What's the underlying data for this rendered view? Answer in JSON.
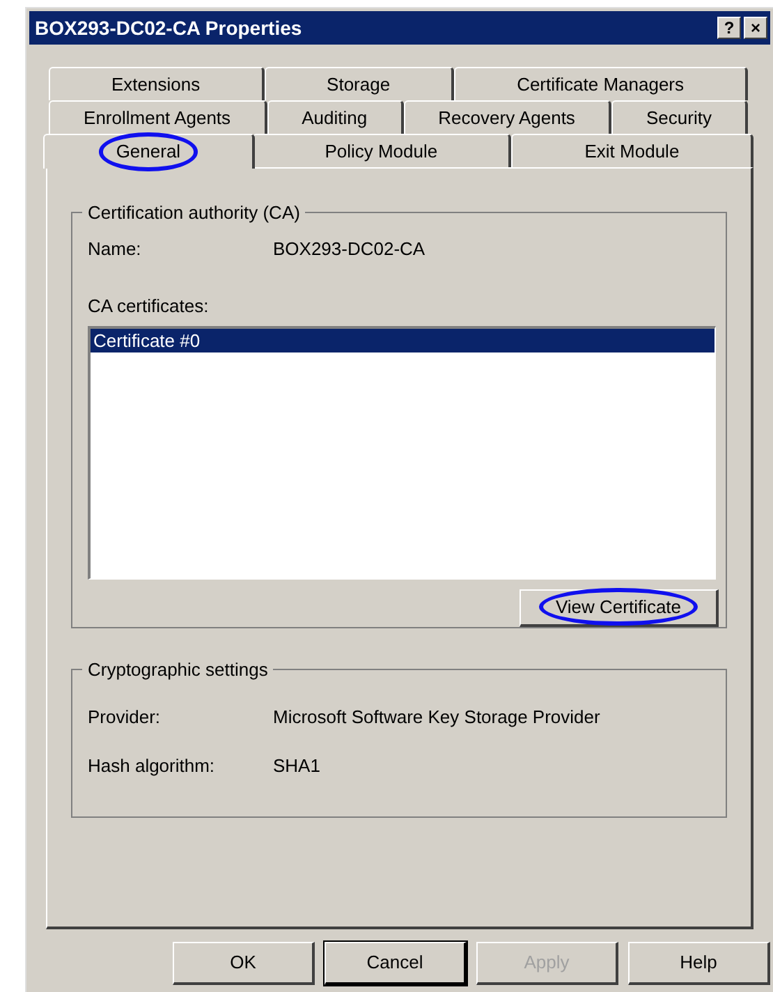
{
  "window": {
    "title": "BOX293-DC02-CA Properties",
    "title_buttons": [
      "?",
      "×"
    ]
  },
  "tab_rows": [
    [
      {
        "label": "Extensions",
        "selected": false,
        "highlighted": false
      },
      {
        "label": "Storage",
        "selected": false,
        "highlighted": false
      },
      {
        "label": "Certificate Managers",
        "selected": false,
        "highlighted": false
      }
    ],
    [
      {
        "label": "Enrollment Agents",
        "selected": false,
        "highlighted": false
      },
      {
        "label": "Auditing",
        "selected": false,
        "highlighted": false
      },
      {
        "label": "Recovery Agents",
        "selected": false,
        "highlighted": false
      },
      {
        "label": "Security",
        "selected": false,
        "highlighted": false
      }
    ],
    [
      {
        "label": "General",
        "selected": true,
        "highlighted": true
      },
      {
        "label": "Policy Module",
        "selected": false,
        "highlighted": false
      },
      {
        "label": "Exit Module",
        "selected": false,
        "highlighted": false
      }
    ]
  ],
  "ca_group": {
    "title": "Certification authority (CA)",
    "name_label": "Name:",
    "name_value": "BOX293-DC02-CA",
    "certificates_label": "CA certificates:",
    "certificates": [
      {
        "label": "Certificate #0",
        "selected": true
      }
    ],
    "view_button": {
      "label": "View Certificate",
      "highlighted": true
    }
  },
  "crypto_group": {
    "title": "Cryptographic settings",
    "fields": [
      {
        "label": "Provider:",
        "value": "Microsoft Software Key Storage Provider"
      },
      {
        "label": "Hash algorithm:",
        "value": "SHA1"
      }
    ]
  },
  "buttons": [
    {
      "label": "OK",
      "default": false,
      "disabled": false
    },
    {
      "label": "Cancel",
      "default": true,
      "disabled": false
    },
    {
      "label": "Apply",
      "default": false,
      "disabled": true
    },
    {
      "label": "Help",
      "default": false,
      "disabled": false
    }
  ]
}
